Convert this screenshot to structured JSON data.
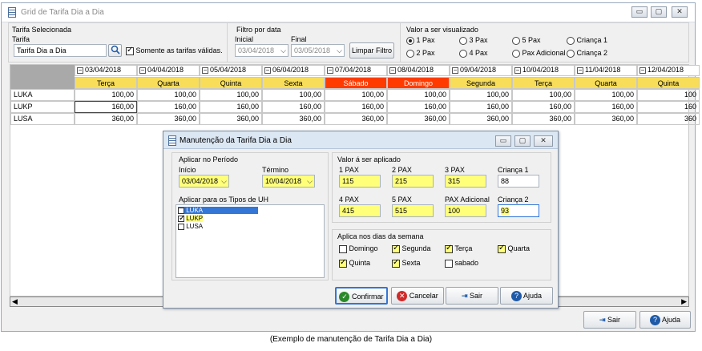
{
  "window": {
    "title": "Grid de Tarifa Dia a Dia",
    "min_label": "▭",
    "max_label": "▢",
    "close_label": "✕"
  },
  "tarifa_group": {
    "title": "Tarifa Selecionada",
    "label": "Tarifa",
    "value": "Tarifa Dia a Dia",
    "only_valid_label": "Somente as tarifas válidas.",
    "only_valid_checked": true
  },
  "filtro_group": {
    "title": "Filtro por data",
    "inicial_label": "Inicial",
    "inicial_value": "03/04/2018",
    "final_label": "Final",
    "final_value": "03/05/2018",
    "limpar_label": "Limpar Filtro"
  },
  "valor_group": {
    "title": "Valor a ser visualizado",
    "options": [
      "1 Pax",
      "2 Pax",
      "3 Pax",
      "4 Pax",
      "5 Pax",
      "Pax Adicional",
      "Criança 1",
      "Criança 2"
    ],
    "selected": "1 Pax"
  },
  "grid": {
    "dates": [
      "03/04/2018",
      "04/04/2018",
      "05/04/2018",
      "06/04/2018",
      "07/04/2018",
      "08/04/2018",
      "09/04/2018",
      "10/04/2018",
      "11/04/2018",
      "12/04/2018"
    ],
    "days": [
      "Terça",
      "Quarta",
      "Quinta",
      "Sexta",
      "Sábado",
      "Domingo",
      "Segunda",
      "Terça",
      "Quarta",
      "Quinta"
    ],
    "weekend": [
      false,
      false,
      false,
      false,
      true,
      true,
      false,
      false,
      false,
      false
    ],
    "rows": [
      {
        "name": "LUKA",
        "values": [
          "100,00",
          "100,00",
          "100,00",
          "100,00",
          "100,00",
          "100,00",
          "100,00",
          "100,00",
          "100,00",
          "100"
        ]
      },
      {
        "name": "LUKP",
        "values": [
          "160,00",
          "160,00",
          "160,00",
          "160,00",
          "160,00",
          "160,00",
          "160,00",
          "160,00",
          "160,00",
          "160"
        ]
      },
      {
        "name": "LUSA",
        "values": [
          "360,00",
          "360,00",
          "360,00",
          "360,00",
          "360,00",
          "360,00",
          "360,00",
          "360,00",
          "360,00",
          "360"
        ]
      }
    ]
  },
  "dialog": {
    "title": "Manutenção da Tarifa Dia a Dia",
    "periodo_title": "Aplicar no Período",
    "inicio_label": "Início",
    "inicio_value": "03/04/2018",
    "termino_label": "Término",
    "termino_value": "10/04/2018",
    "tipos_title": "Aplicar para os Tipos de UH",
    "tipos": [
      {
        "name": "LUKA",
        "checked": false,
        "selected": true
      },
      {
        "name": "LUKP",
        "checked": true,
        "selected": false
      },
      {
        "name": "LUSA",
        "checked": false,
        "selected": false
      }
    ],
    "valor_title": "Valor á ser aplicado",
    "fields": [
      {
        "label": "1 PAX",
        "value": "115"
      },
      {
        "label": "2 PAX",
        "value": "215"
      },
      {
        "label": "3 PAX",
        "value": "315"
      },
      {
        "label": "Criança 1",
        "value": "88"
      },
      {
        "label": "4 PAX",
        "value": "415"
      },
      {
        "label": "5 PAX",
        "value": "515"
      },
      {
        "label": "PAX Adicional",
        "value": "100"
      },
      {
        "label": "Criança 2",
        "value": "93"
      }
    ],
    "dias_title": "Aplica nos dias da semana",
    "dias": [
      {
        "name": "Domingo",
        "checked": false
      },
      {
        "name": "Segunda",
        "checked": true
      },
      {
        "name": "Terça",
        "checked": true
      },
      {
        "name": "Quarta",
        "checked": true
      },
      {
        "name": "Quinta",
        "checked": true
      },
      {
        "name": "Sexta",
        "checked": true
      },
      {
        "name": "sabado",
        "checked": false
      }
    ],
    "confirmar_label": "Confirmar",
    "cancelar_label": "Cancelar",
    "sair_label": "Sair",
    "ajuda_label": "Ajuda"
  },
  "footer": {
    "sair_label": "Sair",
    "ajuda_label": "Ajuda"
  },
  "caption": "(Exemplo de manutenção de Tarifa Dia a Dia)"
}
